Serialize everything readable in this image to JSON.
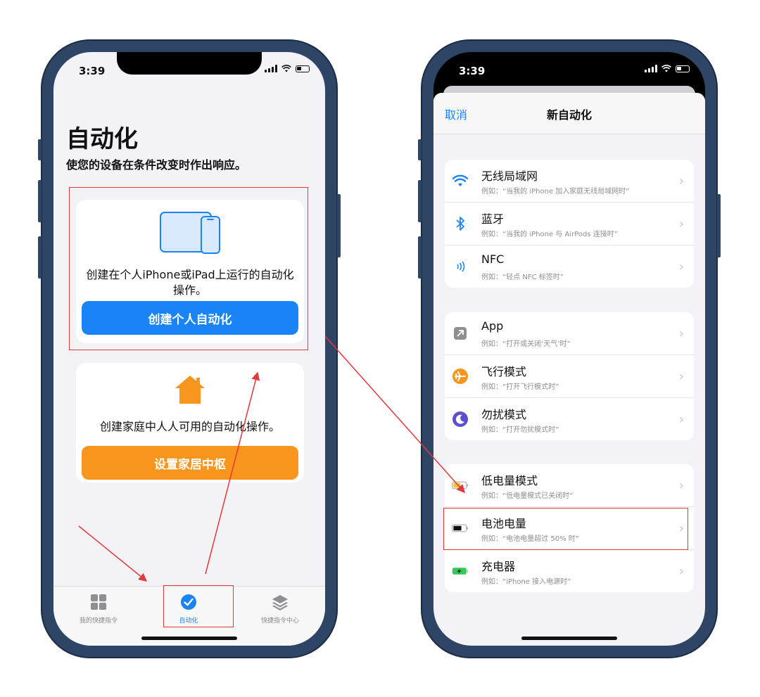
{
  "left_phone": {
    "status_time": "3:39",
    "title": "自动化",
    "subtitle": "使您的设备在条件改变时作出响应。",
    "personal_card": {
      "description": "创建在个人iPhone或iPad上运行的自动化操作。",
      "button_label": "创建个人自动化",
      "icon": "ipad-iphone-icon"
    },
    "home_card": {
      "description": "创建家庭中人人可用的自动化操作。",
      "button_label": "设置家居中枢",
      "icon": "home-icon"
    },
    "tabs": [
      {
        "label": "我的快捷指令",
        "icon": "grid-icon"
      },
      {
        "label": "自动化",
        "icon": "clock-check-icon",
        "active": true
      },
      {
        "label": "快捷指令中心",
        "icon": "layers-icon"
      }
    ]
  },
  "right_phone": {
    "status_time": "3:39",
    "nav": {
      "cancel": "取消",
      "title": "新自动化"
    },
    "groups": [
      [
        {
          "title": "无线局域网",
          "subtitle": "例如：“当我的 iPhone 加入家庭无线局域网时”",
          "icon": "wifi-icon"
        },
        {
          "title": "蓝牙",
          "subtitle": "例如：“当我的 iPhone 与 AirPods 连接时”",
          "icon": "bluetooth-icon"
        },
        {
          "title": "NFC",
          "subtitle": "例如：“轻点 NFC 标签时”",
          "icon": "nfc-icon"
        }
      ],
      [
        {
          "title": "App",
          "subtitle": "例如：“打开或关闭‘天气’时”",
          "icon": "app-icon"
        },
        {
          "title": "飞行模式",
          "subtitle": "例如：“打开飞行模式时”",
          "icon": "airplane-icon"
        },
        {
          "title": "勿扰模式",
          "subtitle": "例如：“打开勿扰模式时”",
          "icon": "moon-icon"
        }
      ],
      [
        {
          "title": "低电量模式",
          "subtitle": "例如：“低电量模式已关闭时”",
          "icon": "low-battery-icon"
        },
        {
          "title": "电池电量",
          "subtitle": "例如：“电池电量超过 50% 时”",
          "icon": "battery-icon"
        },
        {
          "title": "充电器",
          "subtitle": "例如：“iPhone 接入电源时”",
          "icon": "charging-icon"
        }
      ]
    ]
  },
  "colors": {
    "accent_blue": "#1a84f6",
    "accent_orange": "#f7951c",
    "highlight_red": "#e23a3a"
  }
}
